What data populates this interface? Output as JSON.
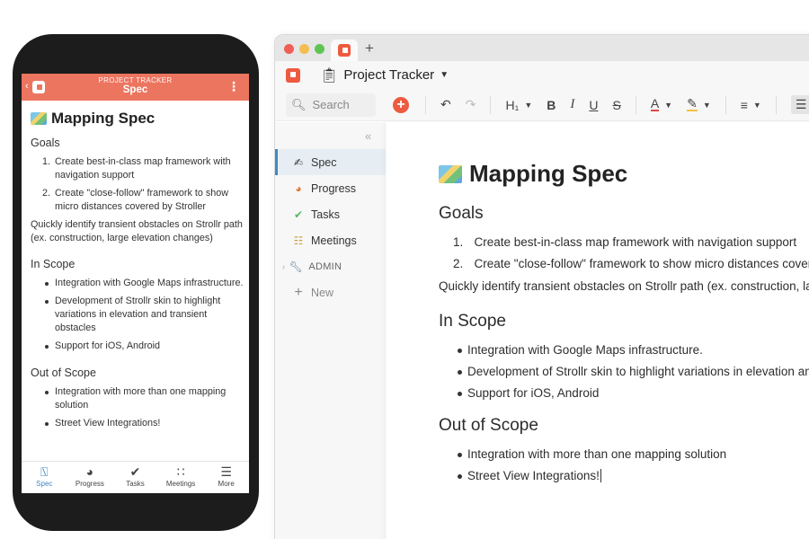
{
  "desktop": {
    "tab_plus": "+",
    "doc_title": "Project Tracker",
    "search_placeholder": "Search",
    "toolbar": {
      "heading": "H₁",
      "bold": "B",
      "italic": "I",
      "underline": "U",
      "strike": "S",
      "text_color": "A"
    },
    "sidebar": {
      "items": [
        {
          "label": "Spec",
          "icon": "writing-hand-icon",
          "glyph": "✍",
          "active": true
        },
        {
          "label": "Progress",
          "icon": "pie-chart-icon",
          "glyph": "◕",
          "active": false
        },
        {
          "label": "Tasks",
          "icon": "check-circle-icon",
          "glyph": "✔",
          "active": false
        },
        {
          "label": "Meetings",
          "icon": "people-icon",
          "glyph": "☷",
          "active": false
        }
      ],
      "admin": "ADMIN",
      "new": "New"
    },
    "doc": {
      "title": "Mapping Spec",
      "goals_heading": "Goals",
      "goals": [
        "Create best-in-class map framework with navigation support",
        "Create \"close-follow\" framework to show micro distances covered by"
      ],
      "goals_para": "Quickly identify transient obstacles on Strollr path (ex. construction, large",
      "in_scope_heading": "In Scope",
      "in_scope": [
        "Integration with Google Maps infrastructure.",
        "Development of Strollr skin to highlight variations in elevation and t",
        "Support for iOS, Android"
      ],
      "out_scope_heading": "Out of Scope",
      "out_scope": [
        "Integration with more than one mapping solution",
        "Street View Integrations!"
      ]
    }
  },
  "mobile": {
    "header_super": "PROJECT TRACKER",
    "header_title": "Spec",
    "doc": {
      "title": "Mapping Spec",
      "goals_heading": "Goals",
      "goals": [
        "Create best-in-class map framework with navigation support",
        "Create \"close-follow\" framework to show micro distances covered by Stroller"
      ],
      "goals_para": "Quickly identify transient obstacles on Strollr path (ex. construction, large elevation changes)",
      "in_scope_heading": "In Scope",
      "in_scope": [
        "Integration with Google Maps infrastructure.",
        "Development of Strollr skin to highlight variations in elevation and transient obstacles",
        "Support for iOS, Android"
      ],
      "out_scope_heading": "Out of Scope",
      "out_scope": [
        "Integration with more than one mapping solution",
        "Street View Integrations!"
      ]
    },
    "tabs": [
      {
        "label": "Spec",
        "icon": "spec-icon",
        "glyph": "⍂",
        "active": true
      },
      {
        "label": "Progress",
        "icon": "pie-chart-icon",
        "glyph": "◕",
        "active": false
      },
      {
        "label": "Tasks",
        "icon": "check-circle-icon",
        "glyph": "✔",
        "active": false
      },
      {
        "label": "Meetings",
        "icon": "people-icon",
        "glyph": "∷",
        "active": false
      },
      {
        "label": "More",
        "icon": "menu-icon",
        "glyph": "☰",
        "active": false
      }
    ]
  },
  "colors": {
    "brand": "#ee5a40",
    "mobile_header": "#ec7560",
    "active_accent": "#3f88c5"
  }
}
